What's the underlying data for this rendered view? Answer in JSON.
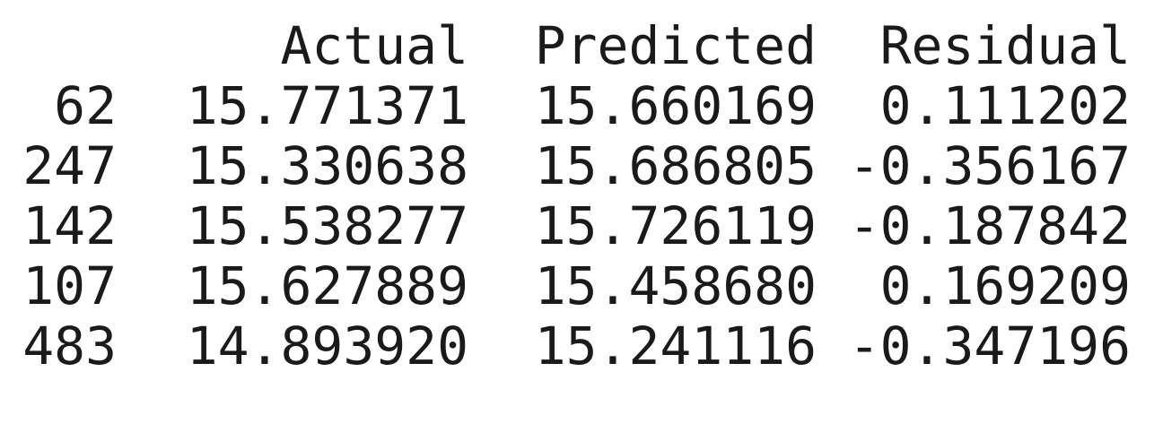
{
  "table": {
    "columns": [
      "Actual",
      "Predicted",
      "Residual"
    ],
    "rows": [
      {
        "index": "62",
        "actual": "15.771371",
        "predicted": "15.660169",
        "residual": "0.111202"
      },
      {
        "index": "247",
        "actual": "15.330638",
        "predicted": "15.686805",
        "residual": "-0.356167"
      },
      {
        "index": "142",
        "actual": "15.538277",
        "predicted": "15.726119",
        "residual": "-0.187842"
      },
      {
        "index": "107",
        "actual": "15.627889",
        "predicted": "15.458680",
        "residual": "0.169209"
      },
      {
        "index": "483",
        "actual": "14.893920",
        "predicted": "15.241116",
        "residual": "-0.347196"
      }
    ]
  }
}
